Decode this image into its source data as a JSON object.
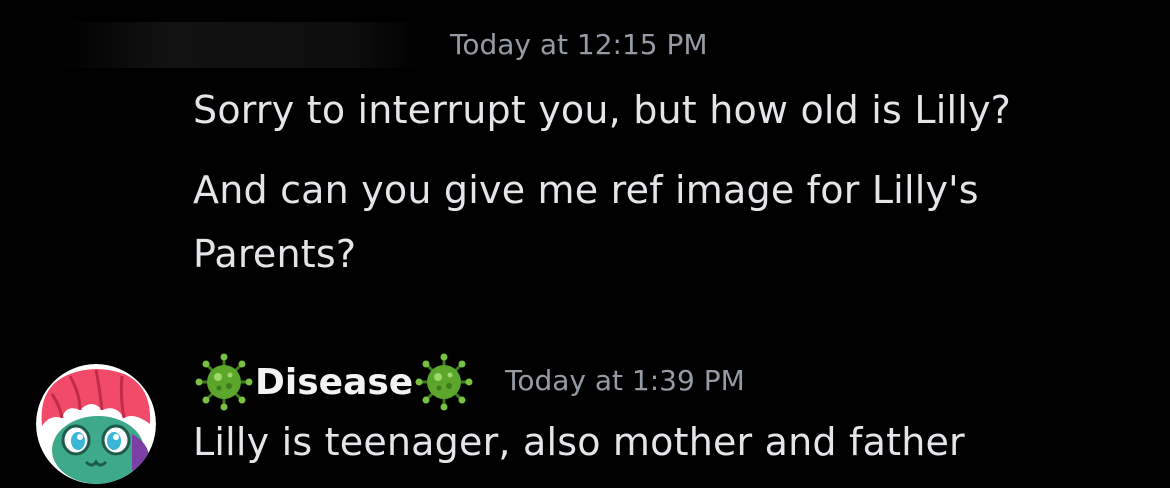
{
  "messages": [
    {
      "timestamp": "Today at 12:15 PM",
      "lines": [
        "Sorry to interrupt you, but how old is Lilly?",
        "And can you give me ref image for Lilly's",
        "Parents?"
      ]
    },
    {
      "author": "Disease",
      "author_decoration_icon": "microbe-icon",
      "timestamp": "Today at 1:39 PM",
      "lines": [
        "Lilly is teenager, also mother and father"
      ]
    }
  ],
  "colors": {
    "background": "#000000",
    "text": "#e3e5e8",
    "timestamp": "#949ba4",
    "microbe": "#5ca62c",
    "avatar_hair": "#f24b6a",
    "avatar_face": "#3fa98c"
  }
}
